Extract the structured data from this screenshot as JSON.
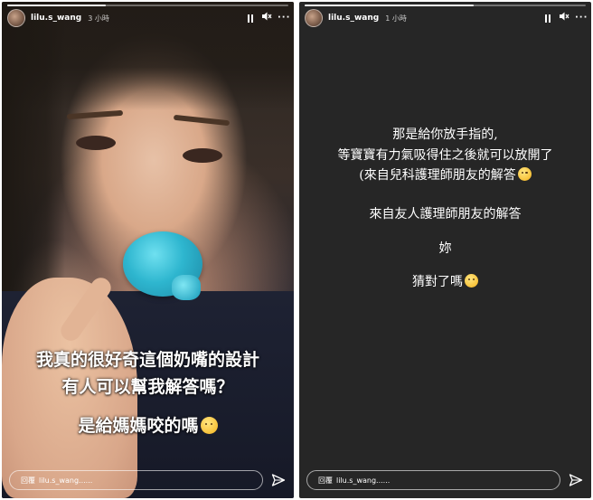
{
  "stories": [
    {
      "username": "lilu.s_wang",
      "time": "3 小時",
      "progress": 0.35,
      "captions": [
        "我真的很好奇這個奶嘴的設計",
        "有人可以幫我解答嗎？",
        "是給媽媽咬的嗎"
      ],
      "reply_placeholder": "回覆",
      "reply_user": "lilu.s_wang......"
    },
    {
      "username": "lilu.s_wang",
      "time": "1 小時",
      "progress": 0.6,
      "lines": [
        "那是給你放手指的,",
        "等寶寶有力氣吸得住之後就可以放開了",
        "(來自兒科護理師朋友的解答",
        "來自友人護理師朋友的解答",
        "妳",
        "猜對了嗎"
      ],
      "reply_placeholder": "回覆",
      "reply_user": "lilu.s_wang......"
    }
  ],
  "icons": {
    "pause": "pause-icon",
    "mute": "muted-speaker-icon",
    "more": "more-icon",
    "send": "send-icon",
    "emoji_star": "star-struck-emoji",
    "emoji_laugh": "laughing-emoji",
    "emoji_rofl": "rofl-emoji"
  },
  "colors": {
    "story_bg_right": "#262626",
    "text": "#ffffff"
  }
}
